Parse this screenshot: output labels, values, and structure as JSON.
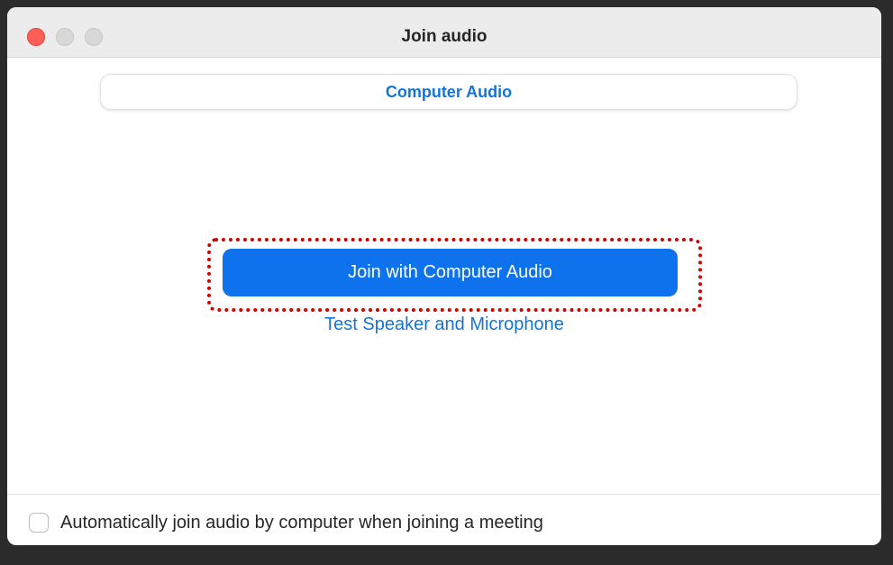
{
  "window": {
    "title": "Join audio"
  },
  "tabs": {
    "selected": "Computer Audio"
  },
  "main": {
    "join_button_label": "Join with Computer Audio",
    "test_link_label": "Test Speaker and Microphone"
  },
  "footer": {
    "auto_join_label": "Automatically join audio by computer when joining a meeting",
    "auto_join_checked": false
  },
  "colors": {
    "accent_blue": "#0e72ec",
    "link_blue": "#1474d6",
    "highlight_red": "#d40000",
    "close_red": "#ff5f57"
  }
}
